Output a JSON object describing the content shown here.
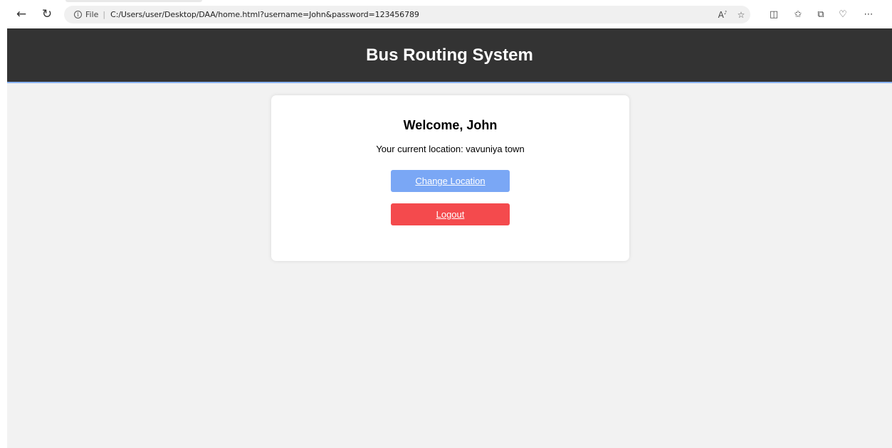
{
  "browser": {
    "file_label": "File",
    "url": "C:/Users/user/Desktop/DAA/home.html?username=John&password=123456789"
  },
  "header": {
    "title": "Bus Routing System",
    "background": "#333333",
    "accent_border": "#8ab4f8"
  },
  "card": {
    "welcome": "Welcome, John",
    "location_text": "Your current location: vavuniya town",
    "change_location_label": "Change Location",
    "logout_label": "Logout",
    "change_location_color": "#7aa7f5",
    "logout_color": "#f44a4d"
  },
  "icons": {
    "back": "back-arrow-icon",
    "refresh": "refresh-icon",
    "info": "info-icon",
    "read_aloud": "read-aloud-icon",
    "favorite": "star-icon",
    "split": "split-screen-icon",
    "favorites": "favorites-icon",
    "collections": "collections-icon",
    "extension": "extension-icon",
    "more": "more-icon"
  }
}
